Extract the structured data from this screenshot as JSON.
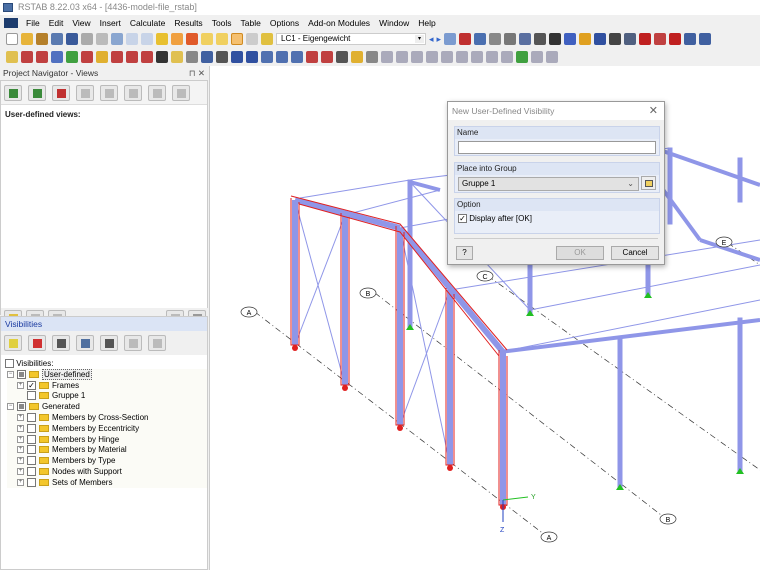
{
  "window": {
    "title": "RSTAB 8.22.03 x64 - [4436-model-file_rstab]"
  },
  "menu": [
    "File",
    "Edit",
    "View",
    "Insert",
    "Calculate",
    "Results",
    "Tools",
    "Table",
    "Options",
    "Add-on Modules",
    "Window",
    "Help"
  ],
  "toolbar": {
    "load_case": "LC1 - Eigengewicht"
  },
  "navigator": {
    "title": "Project Navigator - Views",
    "user_defined_label": "User-defined views:"
  },
  "visibilities": {
    "title": "Visibilities",
    "checkbox_label": "Visibilities:",
    "tree": {
      "user_defined": "User-defined",
      "frames": "Frames",
      "gruppe1": "Gruppe 1",
      "generated": "Generated",
      "generated_items": [
        "Members by Cross-Section",
        "Members by Eccentricity",
        "Members by Hinge",
        "Members by Material",
        "Members by Type",
        "Nodes with Support",
        "Sets of Members"
      ]
    }
  },
  "dialog": {
    "title": "New User-Defined Visibility",
    "name_label": "Name",
    "name_value": "",
    "group_label": "Place into Group",
    "group_value": "Gruppe 1",
    "option_label": "Option",
    "display_after": "Display after [OK]",
    "display_after_checked": true,
    "ok": "OK",
    "cancel": "Cancel"
  },
  "viewport": {
    "axes": [
      "A",
      "B",
      "C",
      "E",
      "B",
      "A"
    ],
    "axis_y": "Y",
    "axis_z": "Z"
  },
  "colors": {
    "member": "#8f96e8",
    "selected": "#e02020",
    "support": "#22c022"
  }
}
